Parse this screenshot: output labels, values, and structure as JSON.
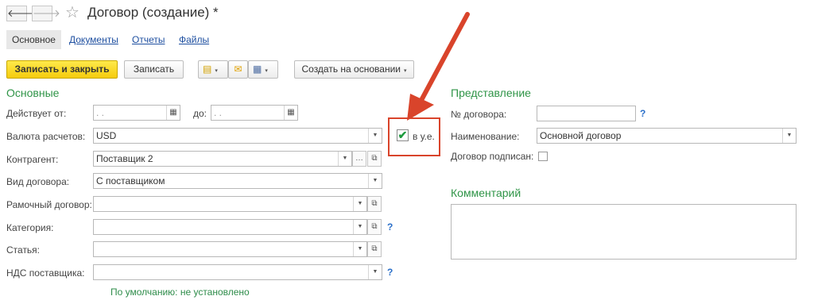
{
  "header": {
    "back_icon": "arrow-left",
    "forward_icon": "arrow-right",
    "star_icon": "star-outline",
    "title": "Договор (создание) *"
  },
  "tabs": [
    {
      "label": "Основное",
      "active": true
    },
    {
      "label": "Документы",
      "active": false
    },
    {
      "label": "Отчеты",
      "active": false
    },
    {
      "label": "Файлы",
      "active": false
    }
  ],
  "toolbar": {
    "save_close_label": "Записать и закрыть",
    "save_label": "Записать",
    "create_based_label": "Создать на основании",
    "icons": [
      "document-icon",
      "envelope-icon",
      "printer-icon"
    ]
  },
  "main": {
    "section_title": "Основные",
    "valid_from_label": "Действует от:",
    "valid_from_value": " .  .",
    "valid_to_label": "до:",
    "valid_to_value": " .  .",
    "currency_label": "Валюта расчетов:",
    "currency_value": "USD",
    "cu_label": "в у.е.",
    "cu_checked": true,
    "counterparty_label": "Контрагент:",
    "counterparty_value": "Поставщик 2",
    "contract_type_label": "Вид договора:",
    "contract_type_value": "С поставщиком",
    "frame_label": "Рамочный договор:",
    "category_label": "Категория:",
    "article_label": "Статья:",
    "vat_label": "НДС поставщика:",
    "default_hint": "По умолчанию: не установлено",
    "help_mark": "?"
  },
  "right": {
    "section_title": "Представление",
    "number_label": "№ договора:",
    "name_label": "Наименование:",
    "name_value": "Основной договор",
    "signed_label": "Договор подписан:",
    "comment_title": "Комментарий"
  },
  "annotation_color": "#d9442b"
}
